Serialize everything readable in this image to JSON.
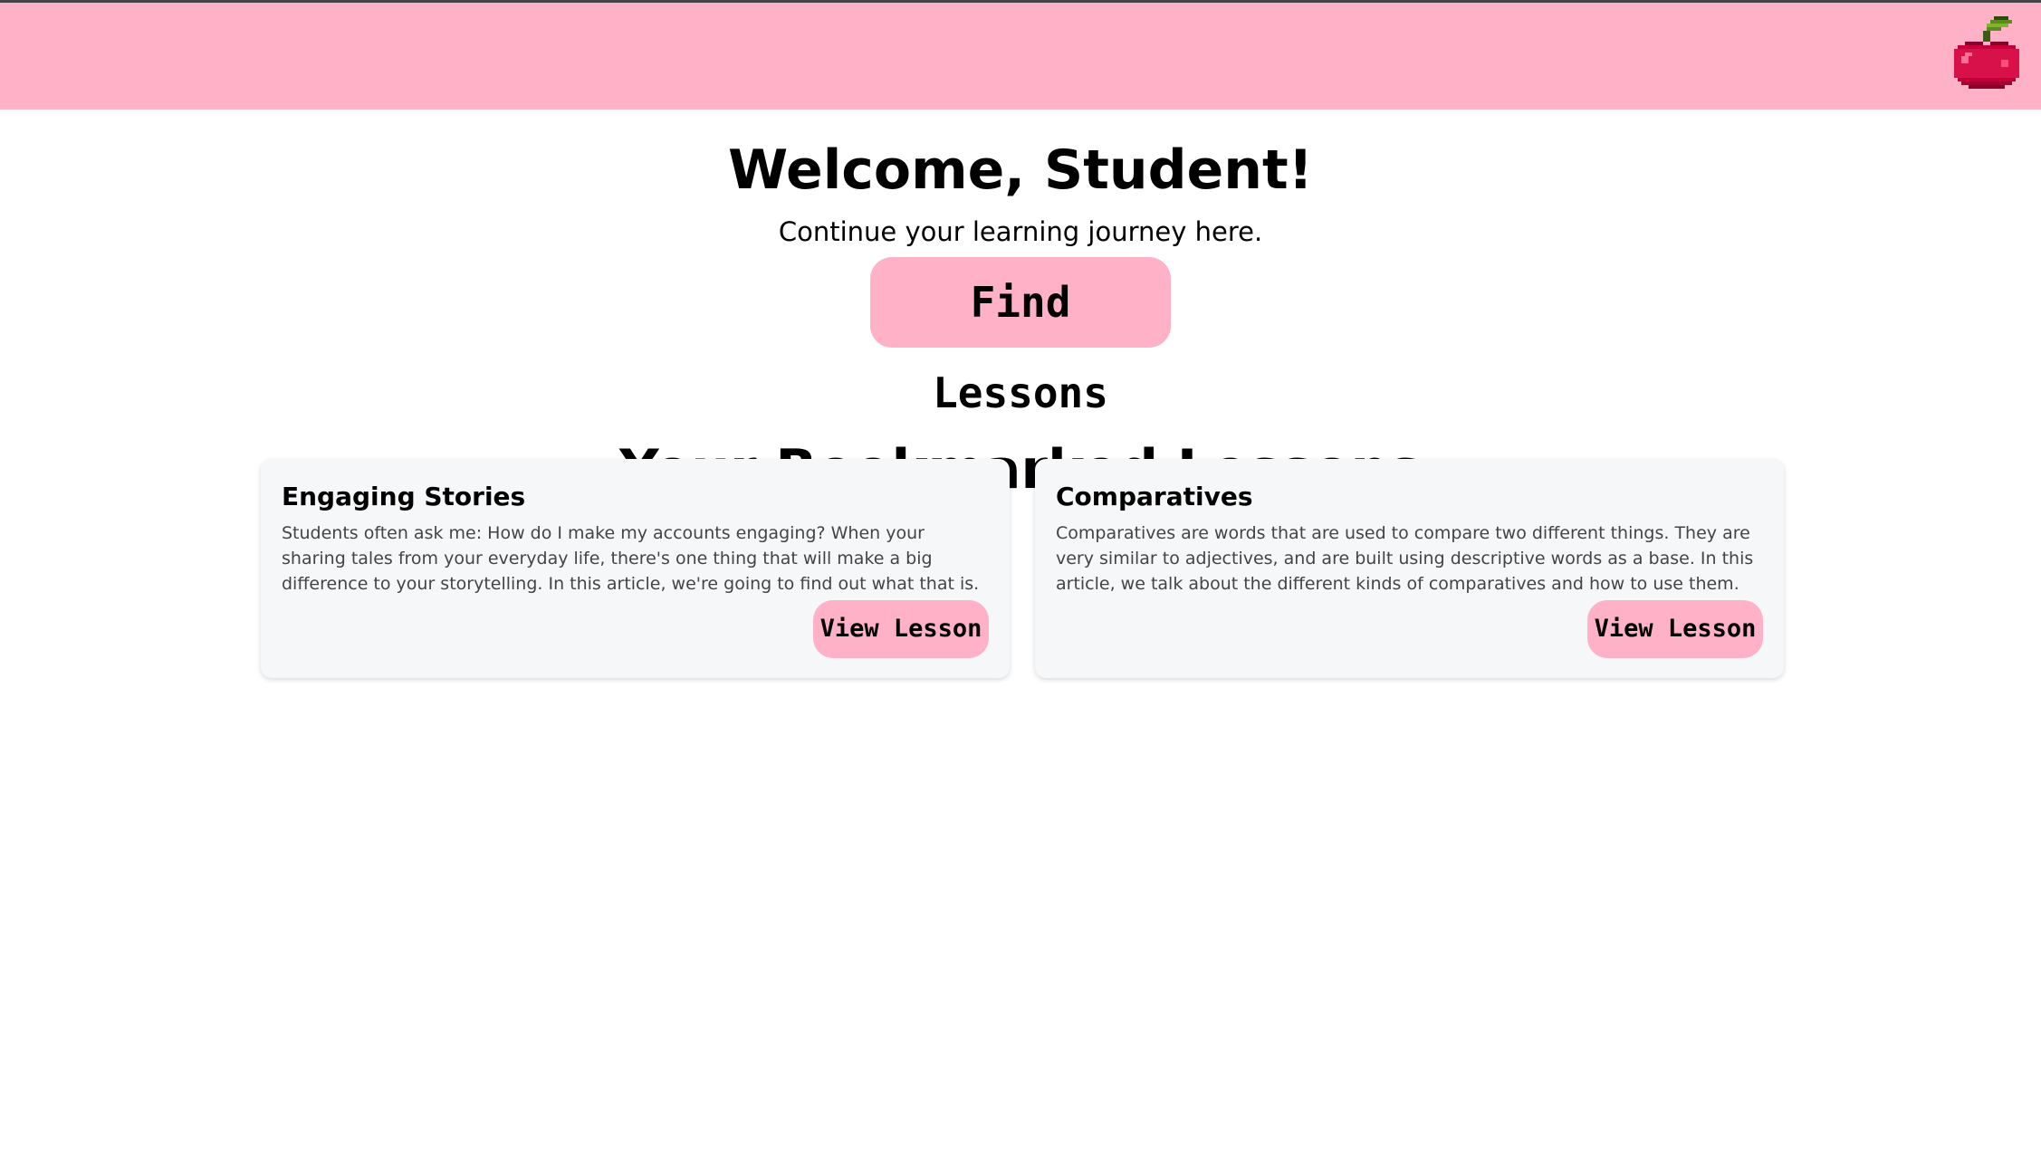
{
  "header": {
    "logo_icon": "cherry-icon",
    "background": "#ffb1c8"
  },
  "hero": {
    "welcome": "Welcome, Student!",
    "subtitle": "Continue your learning journey here.",
    "find_lessons_label": "Find Lessons"
  },
  "bookmarks": {
    "title": "Your Bookmarked Lessons",
    "cards": [
      {
        "title": "Engaging Stories",
        "description": "Students often ask me: How do I make my accounts engaging? When your sharing tales from your everyday life, there's one thing that will make a big difference to your storytelling. In this article, we're going to find out what that is.",
        "button": "View Lesson"
      },
      {
        "title": "Comparatives",
        "description": "Comparatives are words that are used to compare two different things. They are very similar to adjectives, and are built using descriptive words as a base. In this article, we talk about the different kinds of comparatives and how to use them.",
        "button": "View Lesson"
      }
    ]
  }
}
